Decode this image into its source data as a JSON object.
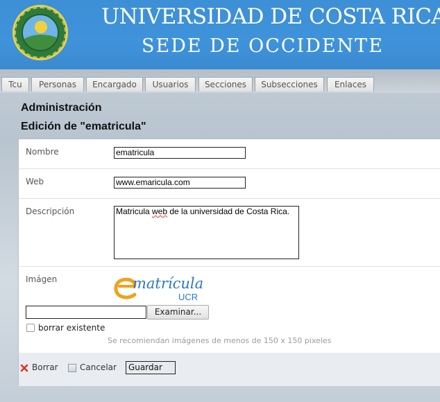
{
  "header": {
    "university_name": "UNIVERSIDAD DE COSTA RICA",
    "campus_name": "SEDE DE OCCIDENTE"
  },
  "tabs": [
    {
      "label": "Tcu"
    },
    {
      "label": "Personas"
    },
    {
      "label": "Encargado"
    },
    {
      "label": "Usuarios"
    },
    {
      "label": "Secciones"
    },
    {
      "label": "Subsecciones"
    },
    {
      "label": "Enlaces"
    }
  ],
  "page": {
    "section_title": "Administración",
    "edit_title": "Edición de \"ematricula\""
  },
  "form": {
    "nombre": {
      "label": "Nombre",
      "value": "ematricula"
    },
    "web": {
      "label": "Web",
      "value": "www.emaricula.com"
    },
    "descripcion": {
      "label": "Descripción",
      "value_part1": "Matricula ",
      "value_spell": "web",
      "value_part2": " de la universidad de Costa Rica."
    },
    "imagen": {
      "label": "Imágen",
      "logo_text": "matrícula",
      "logo_sub": "UCR",
      "file_value": "",
      "browse_label": "Examinar...",
      "delete_existing_label": "borrar existente",
      "delete_existing_checked": false,
      "hint": "Se recomiendan imágenes de menos de 150 x 150 pixeles"
    }
  },
  "actions": {
    "delete_label": "Borrar",
    "cancel_label": "Cancelar",
    "save_label": "Guardar"
  },
  "colors": {
    "header_blue": "#3f93da",
    "logo_orange": "#f0a21c",
    "logo_blue": "#2a78c4",
    "delete_red": "#d9342b"
  }
}
